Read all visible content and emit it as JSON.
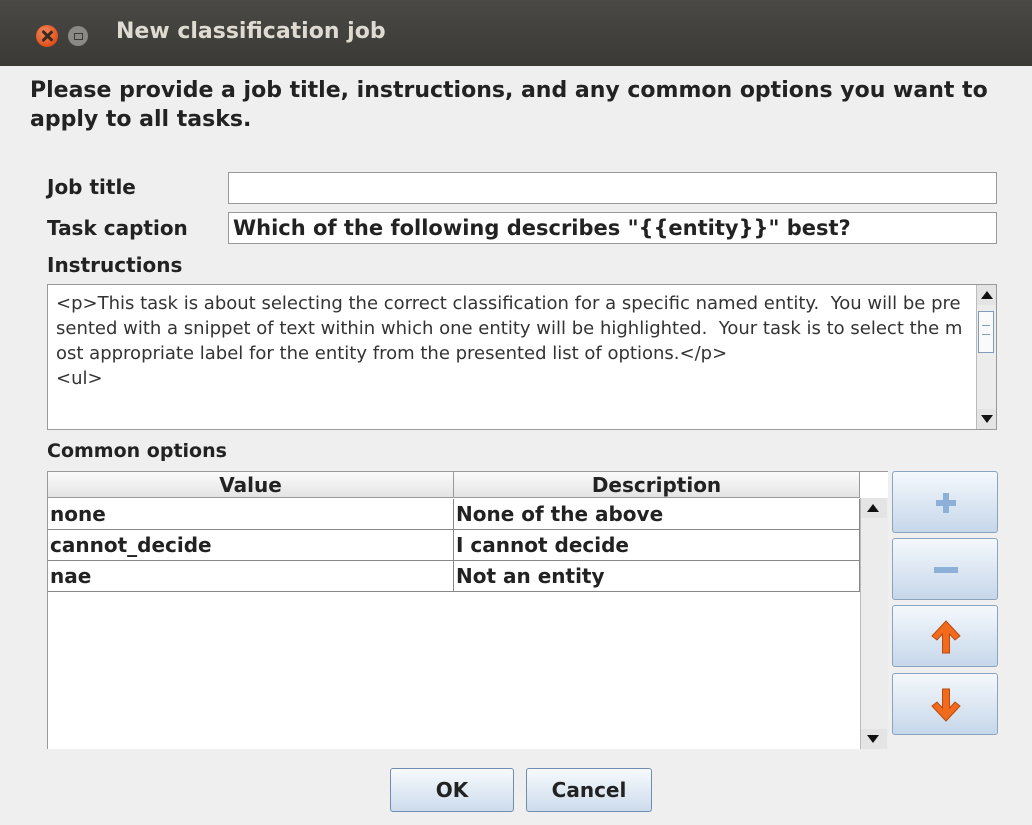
{
  "window": {
    "title": "New classification job"
  },
  "heading": "Please provide a job title, instructions, and any common options you want to apply to all tasks.",
  "form": {
    "job_title_label": "Job title",
    "job_title_value": "",
    "task_caption_label": "Task caption",
    "task_caption_value": "Which of the following describes \"{{entity}}\" best?",
    "instructions_label": "Instructions",
    "instructions_text": "<p>This task is about selecting the correct classification for a specific named entity.  You will be presented with a snippet of text within which one entity will be highlighted.  Your task is to select the most appropriate label for the entity from the presented list of options.</p>\n<ul>"
  },
  "options": {
    "label": "Common options",
    "columns": [
      "Value",
      "Description"
    ],
    "rows": [
      {
        "value": "none",
        "description": "None of the above"
      },
      {
        "value": "cannot_decide",
        "description": "I cannot decide"
      },
      {
        "value": "nae",
        "description": "Not an entity"
      }
    ]
  },
  "side_buttons": {
    "add_icon": "plus-icon",
    "remove_icon": "minus-icon",
    "up_icon": "arrow-up-icon",
    "down_icon": "arrow-down-icon"
  },
  "buttons": {
    "ok": "OK",
    "cancel": "Cancel"
  },
  "colors": {
    "titlebar": "#3c3b37",
    "close": "#e95420",
    "arrow": "#f26b1d",
    "button_accent": "#8db0d8"
  }
}
